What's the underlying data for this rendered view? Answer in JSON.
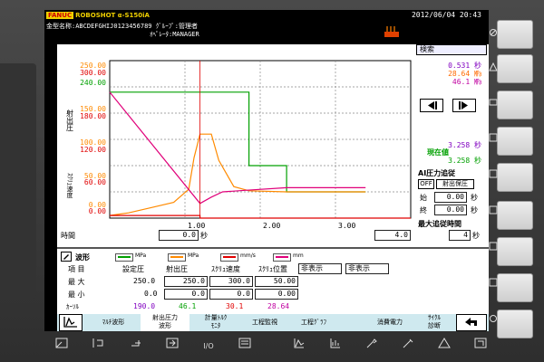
{
  "header": {
    "brand_box": "FANUC",
    "brand_text": "ROBOSHOT α-S150iA",
    "datetime": "2012/06/04 20:43",
    "mold_label": "金型名称:",
    "mold_name": "ABCDEFGHIJ0123456789",
    "group_label": "ｸﾞﾙｰﾌﾟ",
    "group_value": ":管理者",
    "operator_label": "ｵﾍﾟﾚｰﾀ",
    "operator_value": ":MANAGER"
  },
  "chart": {
    "yticks_pressure": [
      "250.00",
      "300.00",
      "240.00",
      "150.00",
      "180.00",
      "100.00",
      "120.00",
      "50.00",
      "60.00",
      "0.00",
      "0.00"
    ],
    "ylabel1": "射出圧",
    "ylabel2": "ｽｸﾘｭ速度",
    "xlabel": "時間",
    "xmin": "0.0",
    "xunit": "秒",
    "xticks": [
      "1.00",
      "2.00",
      "3.00"
    ],
    "xmax": "4.0",
    "xmax2": "4"
  },
  "chart_data": {
    "type": "line",
    "x_range": [
      0,
      4
    ],
    "xticks": [
      1.0,
      2.0,
      3.0
    ],
    "grid": true,
    "series": [
      {
        "color": "#00a000",
        "x": [
          0,
          1.15,
          1.15,
          1.3,
          1.5,
          1.85,
          1.85,
          2.35,
          2.35,
          3.4
        ],
        "y": [
          240,
          240,
          240,
          240,
          240,
          240,
          100,
          100,
          50,
          50
        ]
      },
      {
        "color": "#ff8a00",
        "x": [
          0,
          0.25,
          0.55,
          0.85,
          1.05,
          1.12,
          1.2,
          1.35,
          1.45,
          1.65,
          1.85,
          2.35,
          3.4
        ],
        "y": [
          5,
          10,
          20,
          30,
          55,
          115,
          160,
          160,
          110,
          60,
          52,
          50,
          50
        ]
      },
      {
        "color": "#e0007a",
        "x": [
          0,
          1.2,
          1.2,
          1.35,
          1.5,
          1.8,
          2.35,
          3.4
        ],
        "y": [
          240,
          28,
          28,
          40,
          50,
          53,
          58,
          58
        ]
      },
      {
        "color": "#e00000",
        "x": [
          0,
          1.2,
          1.2,
          4.0
        ],
        "y": [
          5,
          5,
          0,
          0
        ]
      }
    ]
  },
  "right_panel": {
    "search_label": "検索",
    "value1": "0.531",
    "value1_unit": "秒",
    "value2": "28.64",
    "value2_unit": "㎫",
    "value3": "46.1",
    "value3_unit": "㎫",
    "value4": "3.258",
    "value4_unit": "秒",
    "current_label": "現在値",
    "value5": "3.258",
    "value5_unit": "秒",
    "ai_label": "AI圧力追従",
    "off_label": "OFF",
    "hold_label": "射出保圧",
    "start_label": "始",
    "start_value": "0.00",
    "end_label": "終",
    "end_value": "0.00",
    "sec": "秒",
    "max_follow_label": "最大追従時間",
    "max_follow_value": "4",
    "max_follow_unit": "秒"
  },
  "table": {
    "waveform_label": "波形",
    "legend_units": [
      "MPa",
      "MPa",
      "mm/s",
      "mm"
    ],
    "colors": [
      "#00a000",
      "#ff8a00",
      "#e00000",
      "#e0007a"
    ],
    "col_item": "項 目",
    "col_set_pressure": "設定圧",
    "col_injection_pressure": "射出圧",
    "col_screw_speed": "ｽｸﾘｭ速度",
    "col_screw_position": "ｽｸﾘｭ位置",
    "hide_label": "非表示",
    "row_max_label": "最 大",
    "row_min_label": "最 小",
    "row_cursor_label": "ｶｰｿﾙ",
    "max_set": "250.0",
    "max_inj": "250.0",
    "max_speed": "300.0",
    "max_pos": "50.00",
    "min_set": "0.0",
    "min_inj": "0.0",
    "min_speed": "0.0",
    "min_pos": "0.00",
    "cursor_set": "190.0",
    "cursor_inj": "46.1",
    "cursor_speed": "30.1",
    "cursor_pos": "28.64"
  },
  "tabs": [
    {
      "label": "ﾏﾙﾁ波形"
    },
    {
      "label": "射出圧力",
      "label2": "波形"
    },
    {
      "label": "計量ﾄﾙｸ",
      "label2": "ﾓﾆﾀ"
    },
    {
      "label": "工程監視"
    },
    {
      "label": "工程ｸﾞﾗﾌ"
    },
    {
      "label": "消費電力"
    },
    {
      "label": "ｻｲｸﾙ",
      "label2": "診断"
    }
  ],
  "bottom_keys": [
    "I/O"
  ]
}
